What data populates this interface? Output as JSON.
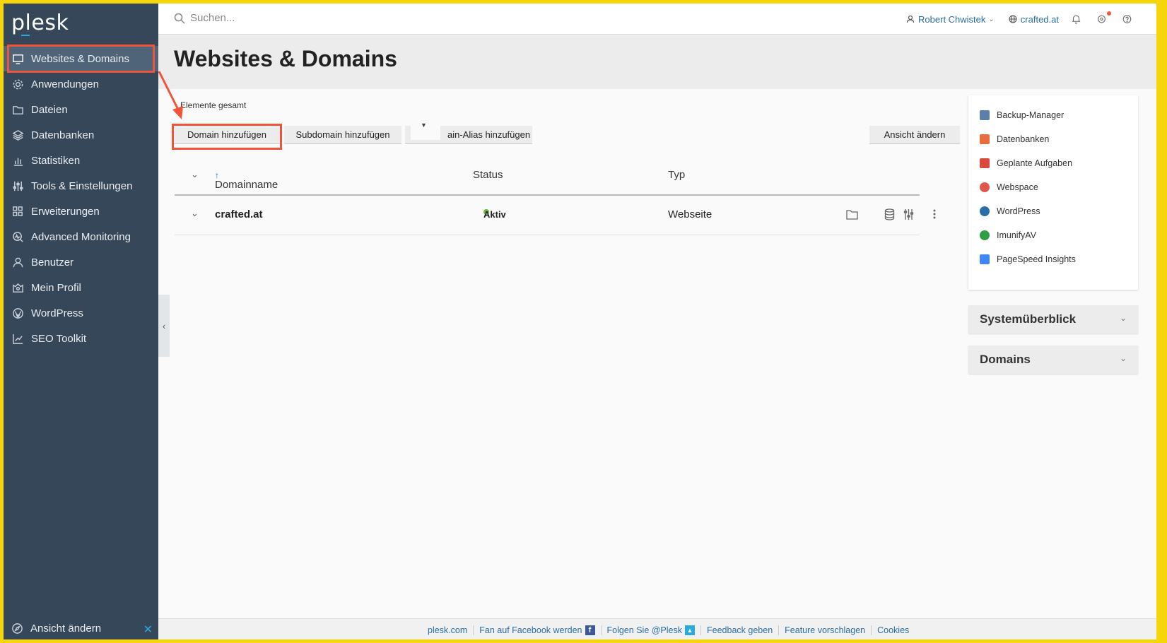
{
  "app": {
    "logo": "plesk"
  },
  "sidebar": {
    "items": [
      {
        "label": "Websites & Domains",
        "icon": "monitor-icon",
        "active": true
      },
      {
        "label": "Anwendungen",
        "icon": "gear-icon"
      },
      {
        "label": "Dateien",
        "icon": "folder-icon"
      },
      {
        "label": "Datenbanken",
        "icon": "layers-icon"
      },
      {
        "label": "Statistiken",
        "icon": "bar-chart-icon"
      },
      {
        "label": "Tools & Einstellungen",
        "icon": "sliders-icon"
      },
      {
        "label": "Erweiterungen",
        "icon": "grid-icon"
      },
      {
        "label": "Advanced Monitoring",
        "icon": "monitoring-icon"
      },
      {
        "label": "Benutzer",
        "icon": "user-icon"
      },
      {
        "label": "Mein Profil",
        "icon": "profile-icon"
      },
      {
        "label": "WordPress",
        "icon": "wordpress-icon"
      },
      {
        "label": "SEO Toolkit",
        "icon": "seo-chart-icon"
      }
    ],
    "bottom_label": "Ansicht ändern",
    "bottom_close": "✕"
  },
  "topbar": {
    "search_placeholder": "Suchen...",
    "user": "Robert Chwistek",
    "domain": "crafted.at"
  },
  "page": {
    "title": "Websites & Domains",
    "total_text": "Elemente gesamt"
  },
  "toolbar": {
    "add_domain": "Domain hinzufügen",
    "add_subdomain": "Subdomain hinzufügen",
    "add_alias": "ain-Alias hinzufügen",
    "change_view": "Ansicht ändern"
  },
  "table": {
    "headers": {
      "name": "Domainname",
      "status": "Status",
      "type": "Typ"
    },
    "sort_indicator": "↑",
    "rows": [
      {
        "name": "crafted.at",
        "status": "Aktiv",
        "type": "Webseite"
      }
    ]
  },
  "right_panel": {
    "links": [
      {
        "label": "Backup-Manager",
        "color": "#5b7fa6"
      },
      {
        "label": "Datenbanken",
        "color": "#e86d3e"
      },
      {
        "label": "Geplante Aufgaben",
        "color": "#d94a3d"
      },
      {
        "label": "Webspace",
        "color": "#e2574c"
      },
      {
        "label": "WordPress",
        "color": "#2b6ea5"
      },
      {
        "label": "ImunifyAV",
        "color": "#2f9e44"
      },
      {
        "label": "PageSpeed Insights",
        "color": "#4285f4"
      }
    ],
    "sections": [
      "Systemüberblick",
      "Domains"
    ]
  },
  "footer": {
    "links": [
      "plesk.com",
      "Fan auf Facebook werden",
      "Folgen Sie @Plesk",
      "Feedback geben",
      "Feature vorschlagen",
      "Cookies"
    ]
  },
  "colors": {
    "sidebar": "#37475a",
    "highlight": "#f0553a",
    "link": "#2b6ea5",
    "status_green": "#6cb33e"
  }
}
